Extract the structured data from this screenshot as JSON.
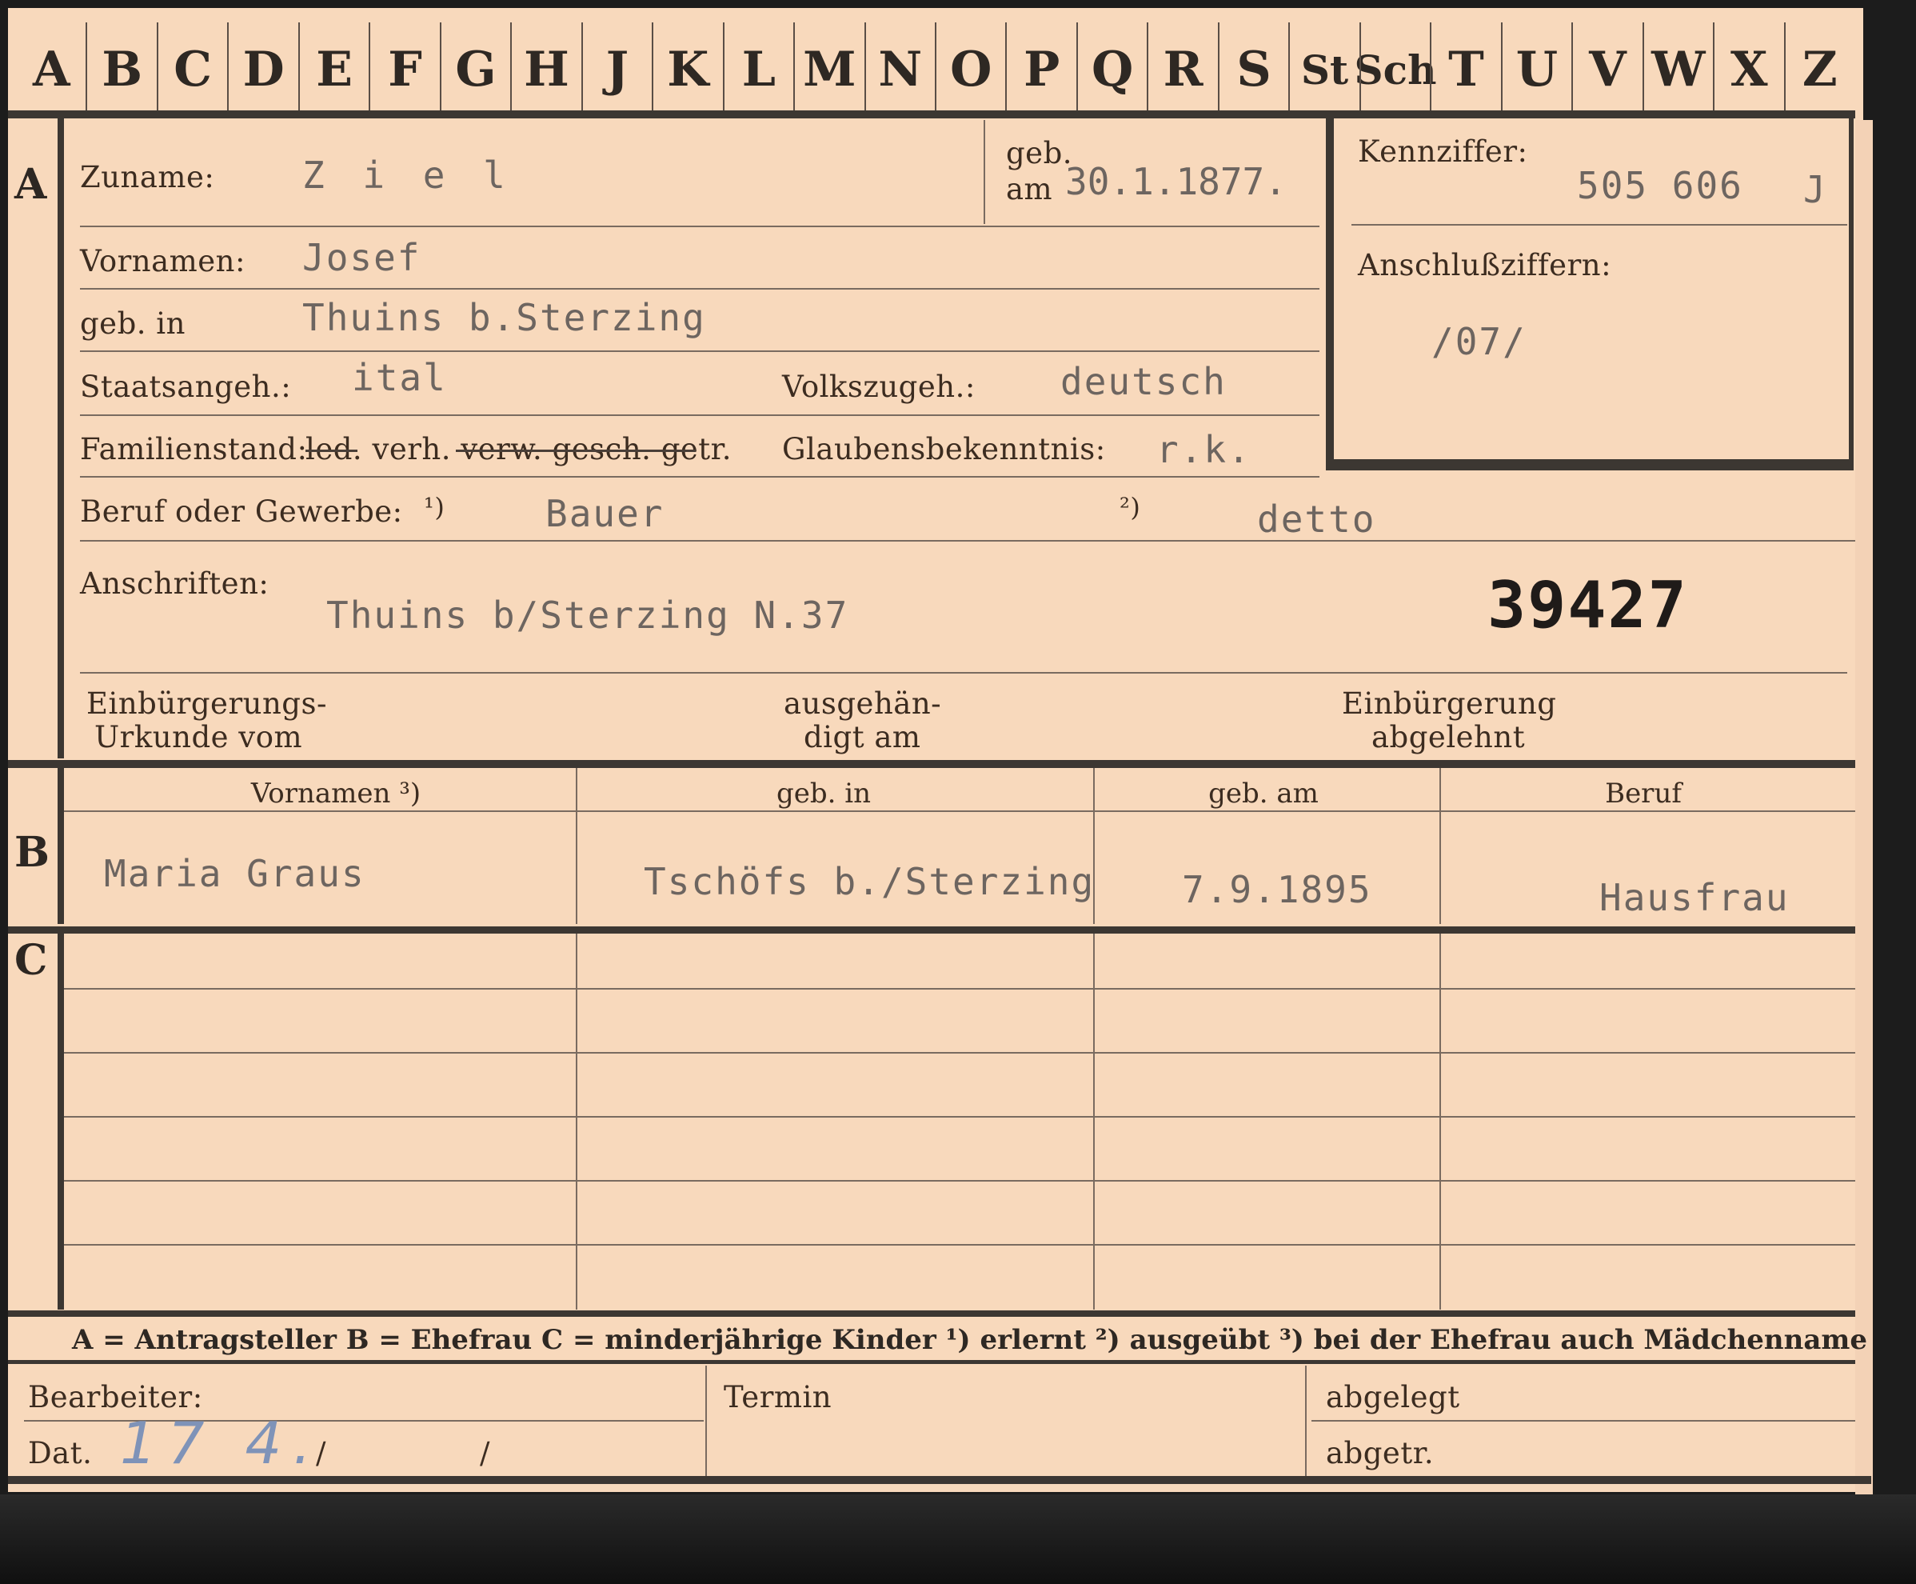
{
  "alphabet": [
    "A",
    "B",
    "C",
    "D",
    "E",
    "F",
    "G",
    "H",
    "J",
    "K",
    "L",
    "M",
    "N",
    "O",
    "P",
    "Q",
    "R",
    "S",
    "St",
    "Sch",
    "T",
    "U",
    "V",
    "W",
    "X",
    "Z"
  ],
  "sections": {
    "a": "A",
    "b": "B",
    "c": "C"
  },
  "labels": {
    "zuname": "Zuname:",
    "geb": "geb.",
    "am": "am",
    "vornamen": "Vornamen:",
    "geb_in": "geb. in",
    "staatsangeh": "Staatsangeh.:",
    "volkszugeh": "Volkszugeh.:",
    "familienstand": "Familienstand:",
    "familienstand_options": "led. verh. verw. gesch. getr.",
    "glaubensbekenntnis": "Glaubensbekenntnis:",
    "beruf": "Beruf oder Gewerbe:",
    "beruf_note1": "¹)",
    "beruf_note2": "²)",
    "anschriften": "Anschriften:",
    "einb_urkunde_1": "Einbürgerungs-",
    "einb_urkunde_2": "Urkunde vom",
    "ausgehaendigt_1": "ausgehän-",
    "ausgehaendigt_2": "digt am",
    "einb_abgelehnt_1": "Einbürgerung",
    "einb_abgelehnt_2": "abgelehnt",
    "kennziffer": "Kennziffer:",
    "anschlussziffern": "Anschlußziffern:",
    "bearbeiter": "Bearbeiter:",
    "dat": "Dat.",
    "termin": "Termin",
    "abgelegt": "abgelegt",
    "abgetr": "abgetr."
  },
  "values": {
    "zuname": "Z i e l",
    "geb_am": "30.1.1877.",
    "vornamen": "Josef",
    "geb_in": "Thuins b.Sterzing",
    "staatsangeh": "ital",
    "volkszugeh": "deutsch",
    "glaubensbekenntnis": "r.k.",
    "beruf_erlernt": "Bauer",
    "beruf_ausgeuebt": "detto",
    "anschriften": "Thuins b/Sterzing  N.37",
    "stamp_number": "39427",
    "kennziffer": "505 606",
    "kennziffer_suffix": "J",
    "anschlussziffern": "/07/",
    "dat_handwritten": "17 4.",
    "dat_sep": "/"
  },
  "table_headers": [
    "Vornamen ³)",
    "geb. in",
    "geb. am",
    "Beruf"
  ],
  "spouse": {
    "vornamen": "Maria Graus",
    "geb_in": "Tschöfs b./Sterzing",
    "geb_am": "7.9.1895",
    "beruf": "Hausfrau"
  },
  "legend": "A = Antragsteller   B = Ehefrau   C = minderjährige Kinder   ¹) erlernt   ²) ausgeübt   ³) bei der Ehefrau auch Mädchenname",
  "colors": {
    "card": "#f8d9bc",
    "ink": "#3c2c20",
    "typed": "#6d6560",
    "rule": "#3c3732",
    "pencil": "#7f93b8"
  }
}
